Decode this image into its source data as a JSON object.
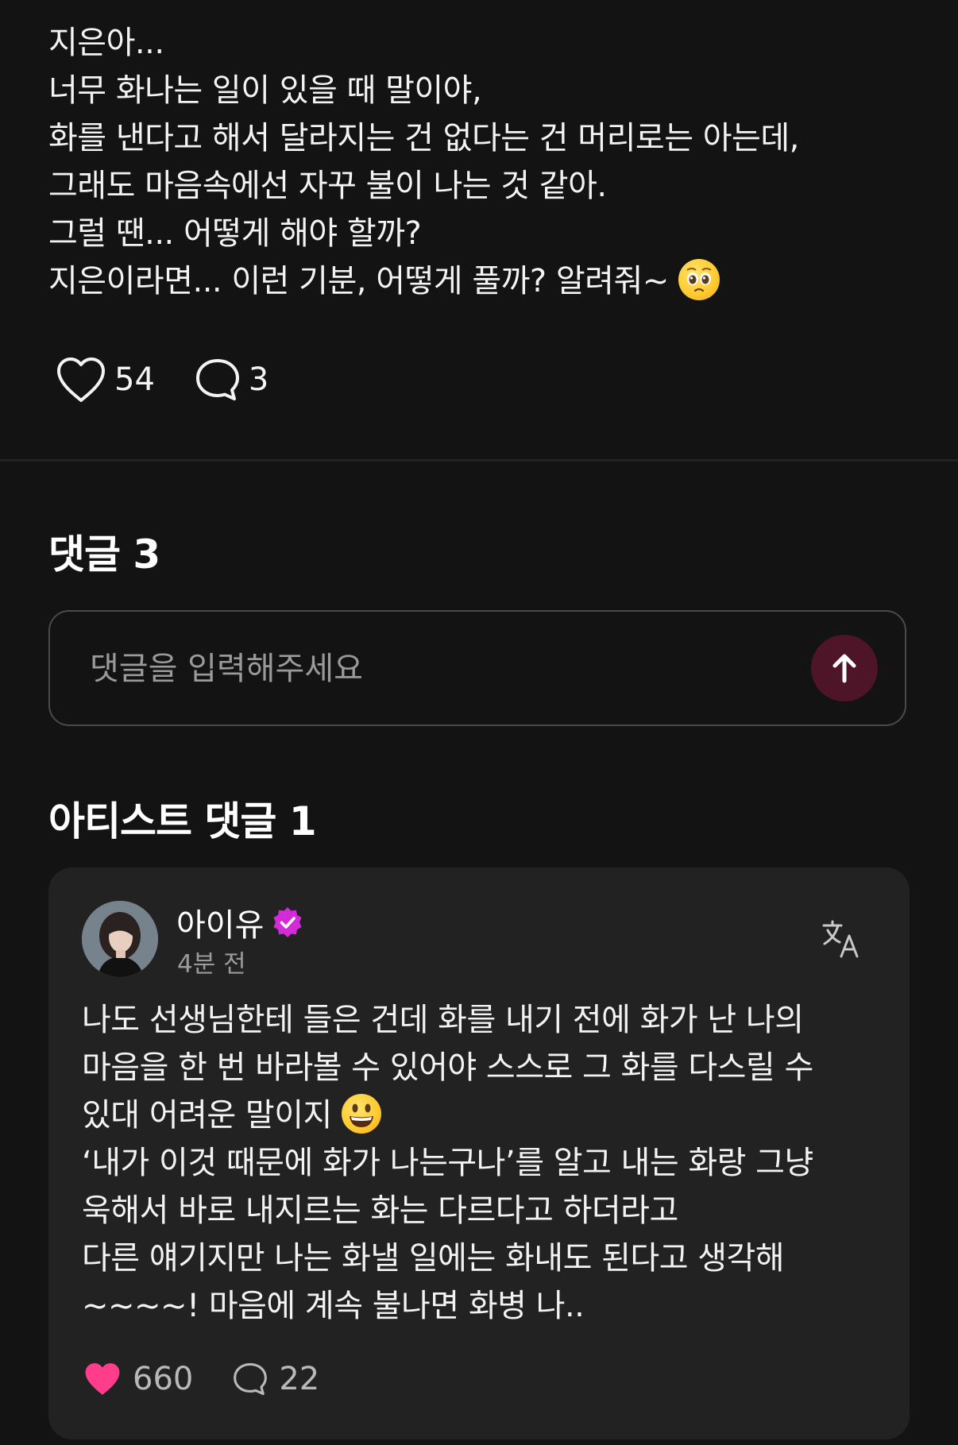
{
  "post": {
    "lines": [
      "지은아...",
      "너무 화나는 일이 있을 때 말이야,",
      "화를 낸다고 해서 달라지는 건 없다는 건 머리로는 아는데,",
      "그래도 마음속에선 자꾸 불이 나는 것 같아.",
      "그럴 땐... 어떻게 해야 할까?",
      "지은이라면... 이런 기분, 어떻게 풀까? 알려줘~"
    ],
    "emoji": "pleading-face",
    "likes": "54",
    "comments": "3"
  },
  "comments_section": {
    "title": "댓글 3",
    "input_placeholder": "댓글을 입력해주세요"
  },
  "artist_section": {
    "title": "아티스트 댓글 1",
    "comment": {
      "author": "아이유",
      "verified": true,
      "time": "4분 전",
      "lines": [
        "나도 선생님한테 들은 건데 화를 내기 전에 화가 난 나의",
        "마음을 한 번 바라볼 수 있어야 스스로 그 화를 다스릴 수",
        "있대 어려운 말이지",
        "‘내가 이것 때문에 화가 나는구나’를 알고 내는 화랑 그냥",
        "욱해서 바로 내지르는 화는 다르다고 하더라고",
        "다른 얘기지만 나는 화낼 일에는 화내도 된다고 생각해",
        "~~~~! 마음에 계속 불나면 화병 나.."
      ],
      "emoji": "grinning-face",
      "likes": "660",
      "replies": "22"
    }
  },
  "colors": {
    "background": "#131313",
    "card": "#222222",
    "send_button": "#4e1428",
    "heart_liked": "#ff3d8b",
    "verified_badge": "#d42bd8"
  }
}
